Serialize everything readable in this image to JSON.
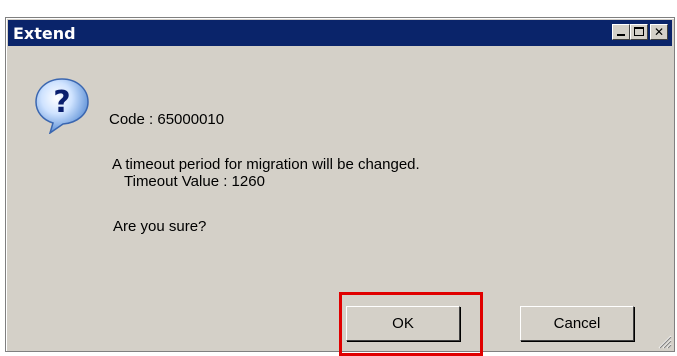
{
  "window": {
    "title": "Extend"
  },
  "titlebar_buttons": {
    "close_glyph": "✕"
  },
  "dialog": {
    "icon": "question-icon",
    "code_label": "Code : 65000010",
    "message_line1": "A timeout period for migration will be changed.",
    "message_line2": "Timeout Value : 1260",
    "question": "Are you sure?"
  },
  "buttons": {
    "ok_label": "OK",
    "cancel_label": "Cancel"
  },
  "colors": {
    "title_bar": "#0a246a",
    "dialog_bg": "#d4d0c8",
    "highlight": "#e00000"
  }
}
